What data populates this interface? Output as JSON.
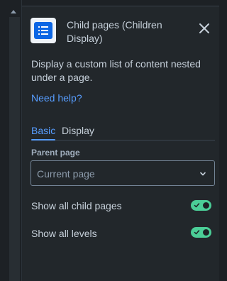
{
  "header": {
    "title": "Child pages (Children Display)",
    "icon": "list-macro-icon"
  },
  "description": "Display a custom list of content nested under a page.",
  "help_link": "Need help?",
  "tabs": [
    {
      "label": "Basic",
      "active": true
    },
    {
      "label": "Display",
      "active": false
    }
  ],
  "parent_page": {
    "label": "Parent page",
    "placeholder": "Current page"
  },
  "options": [
    {
      "label": "Show all child pages",
      "enabled": true
    },
    {
      "label": "Show all levels",
      "enabled": true
    }
  ],
  "colors": {
    "accent": "#579dff",
    "toggle_on": "#4bce97",
    "panel_bg": "#22272b"
  }
}
